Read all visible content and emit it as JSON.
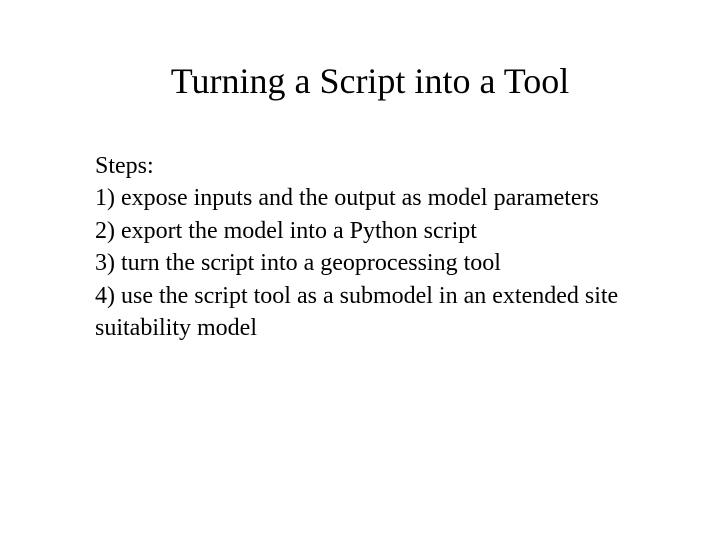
{
  "title": "Turning a Script into a Tool",
  "body": {
    "heading": "Steps:",
    "step1": "1) expose inputs and the output as model parameters",
    "step2": "2) export the model into a Python script",
    "step3": "3) turn the script into a geoprocessing tool",
    "step4": "4) use the script tool as a submodel in an extended site suitability model"
  }
}
